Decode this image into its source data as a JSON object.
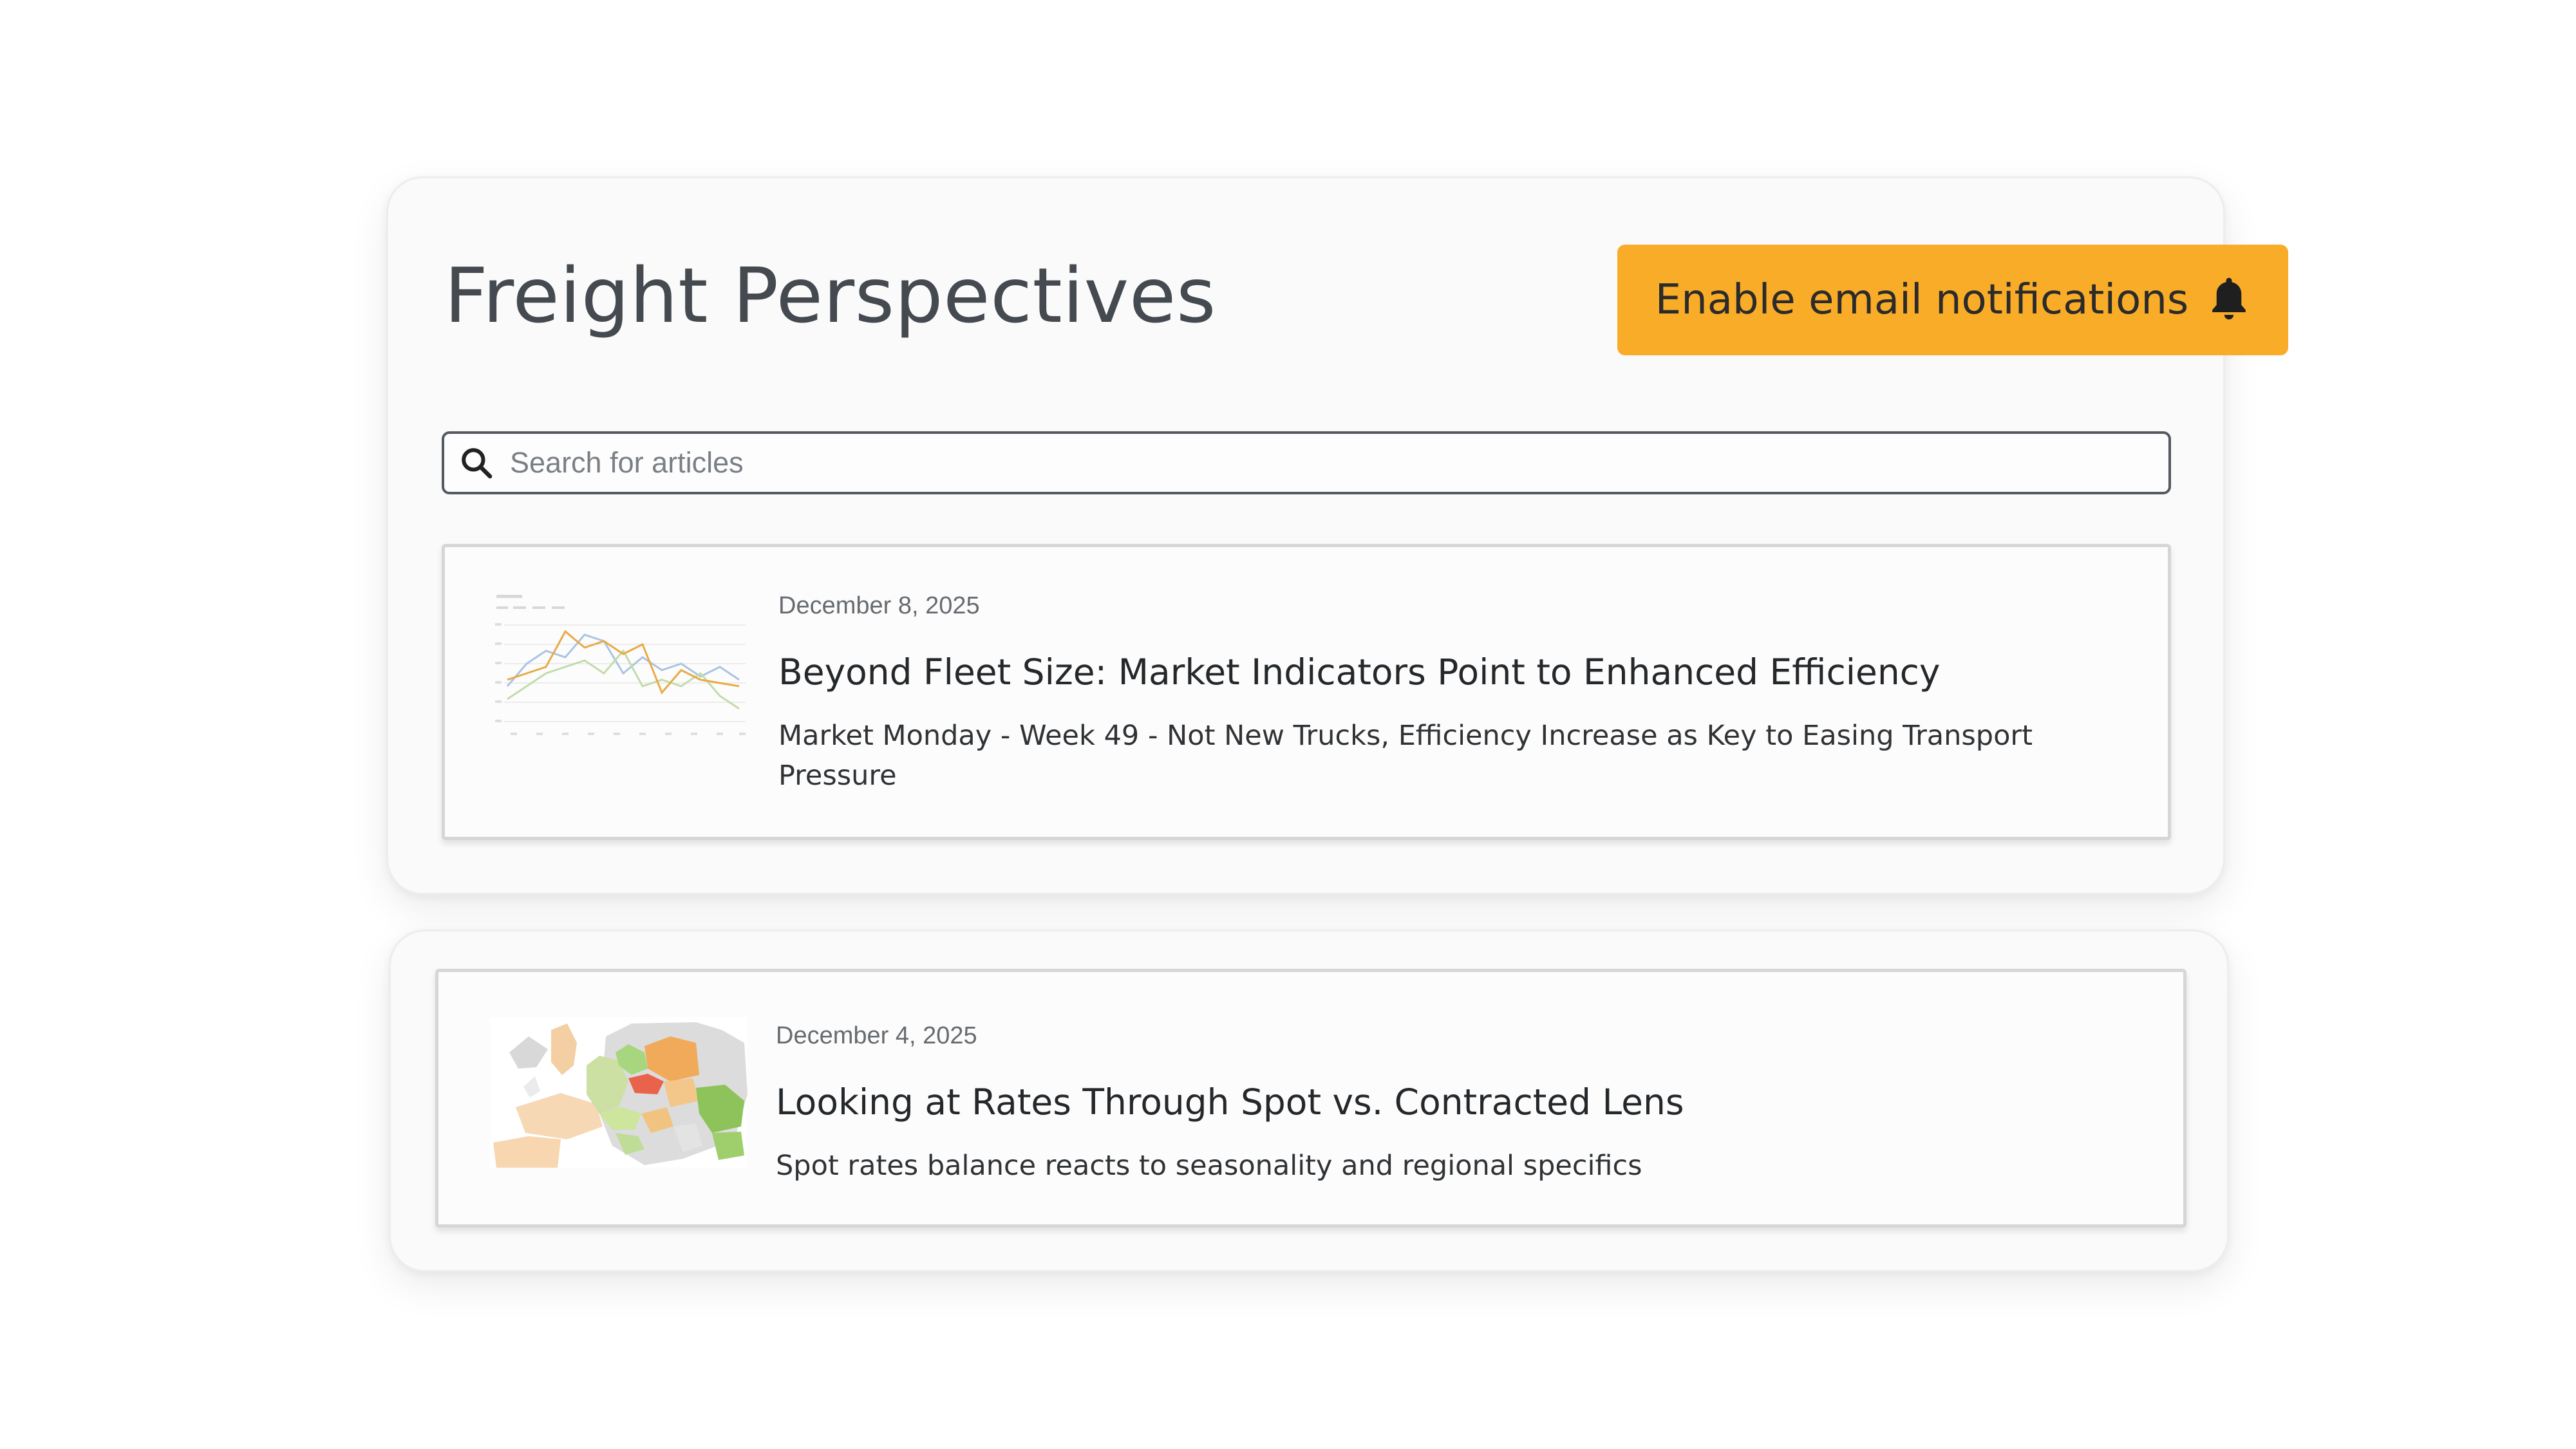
{
  "header": {
    "title": "Freight Perspectives",
    "notify_button_label": "Enable email notifications"
  },
  "search": {
    "placeholder": "Search for articles",
    "value": ""
  },
  "articles": [
    {
      "date": "December 8, 2025",
      "title": "Beyond Fleet Size: Market Indicators Point to Enhanced Efficiency",
      "summary": "Market Monday - Week 49 - Not New Trucks, Efficiency Increase as Key to Easing Transport Pressure",
      "thumbnail": "line-chart-thumbnail"
    },
    {
      "date": "December 4, 2025",
      "title": "Looking at Rates Through Spot vs. Contracted Lens",
      "summary": "Spot rates balance reacts to seasonality and regional specifics",
      "thumbnail": "europe-map-thumbnail"
    }
  ],
  "colors": {
    "accent": "#f9ac28",
    "panel_background": "#fafafa",
    "title_text": "#454a50"
  },
  "icons": {
    "notify": "bell-icon",
    "search": "search-icon"
  }
}
